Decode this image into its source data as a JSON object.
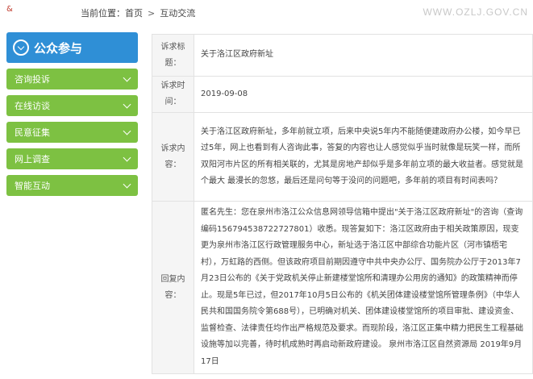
{
  "header": {
    "logo_glyph": "&",
    "breadcrumb_prefix": "当前位置：",
    "breadcrumb_home": "首页",
    "breadcrumb_sep": ">",
    "breadcrumb_current": "互动交流",
    "watermark": "WWW.OZLJ.GOV.CN"
  },
  "sidebar": {
    "title": "公众参与",
    "title_icon": "chevron-down-circle-icon",
    "items": [
      {
        "label": "咨询投诉"
      },
      {
        "label": "在线访谈"
      },
      {
        "label": "民意征集"
      },
      {
        "label": "网上调查"
      },
      {
        "label": "智能互动"
      }
    ],
    "colors": {
      "title_bg": "#2f8fd6",
      "item_bg": "#7dc142"
    }
  },
  "petition": {
    "title_label": "诉求标题：",
    "title_value": "关于洛江区政府新址",
    "time_label": "诉求时间：",
    "time_value": "2019-09-08",
    "content_label": "诉求内容：",
    "content_value": "关于洛江区政府新址，多年前就立项，后来中央说5年内不能随便建政府办公楼，如今早已过5年，网上也看到有人咨询此事，答复的内容也让人感觉似乎当时就像是玩笑一样，而所双阳河市片区的所有相关联的，尤其是房地产却似乎是多年前立项的最大收益者。感觉就是个最大 最漫长的忽悠，最后还是问句等于没问的问题吧，多年前的项目有时间表吗？",
    "reply_label": "回复内容：",
    "reply_value": "匿名先生：您在泉州市洛江公众信息网领导信箱中提出\"关于洛江区政府新址\"的咨询（查询编码156794538722727801）收悉。现答复如下：洛江区政府由于相关政策原因，现变更为泉州市洛江区行政管理服务中心，新址选于洛江区中部综合功能片区（河市镇梧宅村），万虹路的西侧。但该政府项目前期因遵守中共中央办公厅、国务院办公厅于2013年7月23日公布的《关于党政机关停止新建楼堂馆所和清理办公用房的通知》的政策精神而停止。现是5年已过，但2017年10月5日公布的《机关团体建设楼堂馆所管理条例》（中华人民共和国国务院令第688号），已明确对机关、团体建设楼堂馆所的项目审批、建设资金、监督检查、法律责任均作出严格规范及要求。而现阶段，洛江区正集中精力把民生工程基础设施等加以完善，待时机成熟时再启动新政府建设。 泉州市洛江区自然资源局 2019年9月17日"
  }
}
